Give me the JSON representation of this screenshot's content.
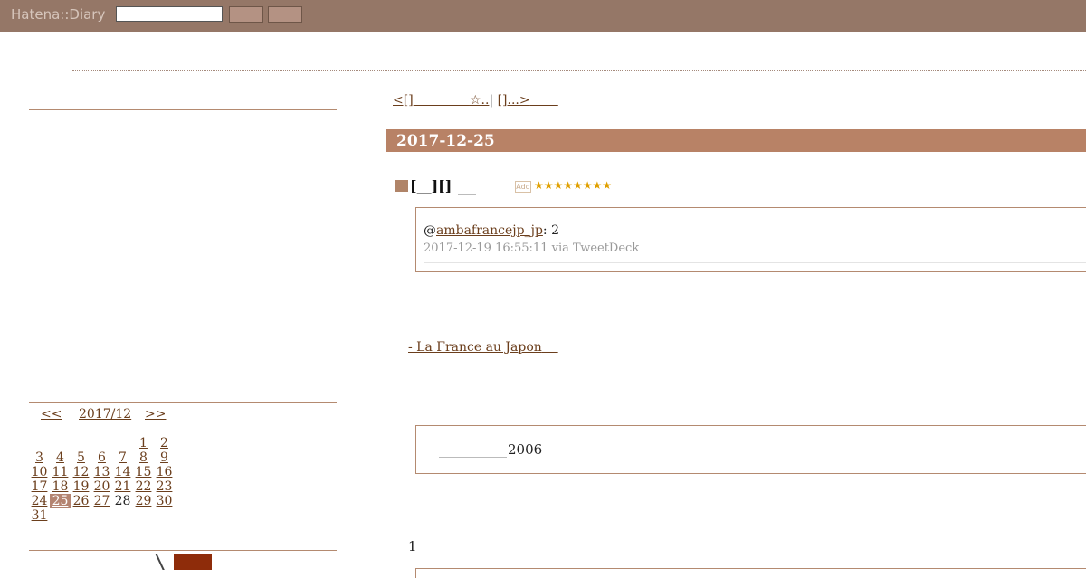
{
  "header": {
    "logo": "Hatena::Diary",
    "search_value": ""
  },
  "pager": {
    "prev": "<[]",
    "star": "☆..",
    "sep": "|",
    "next": "[]...>"
  },
  "calendar": {
    "prev": "<<",
    "month": "2017/12",
    "next": ">>",
    "today": "25",
    "no_entry": [
      "28"
    ],
    "weeks": [
      [
        "",
        "",
        "",
        "",
        "",
        "1",
        "2"
      ],
      [
        "3",
        "4",
        "5",
        "6",
        "7",
        "8",
        "9"
      ],
      [
        "10",
        "11",
        "12",
        "13",
        "14",
        "15",
        "16"
      ],
      [
        "17",
        "18",
        "19",
        "20",
        "21",
        "22",
        "23"
      ],
      [
        "24",
        "25",
        "26",
        "27",
        "28",
        "29",
        "30"
      ],
      [
        "31",
        "",
        "",
        "",
        "",
        "",
        ""
      ]
    ]
  },
  "entry": {
    "date": "2017-12-25",
    "section_title": "[__][]",
    "star_add_label": "Add",
    "stars": "★★★★★★★★",
    "tweet": {
      "prefix": "@",
      "user": "ambafrancejp_jp",
      "suffix": ": 2",
      "meta": "2017-12-19 16:55:11 via TweetDeck"
    },
    "link_text": " - La France au Japon",
    "box_text": "2006",
    "footer_number": "1"
  },
  "colors": {
    "header_bg": "#957767",
    "date_bar": "#b88266",
    "accent": "#b08468"
  }
}
